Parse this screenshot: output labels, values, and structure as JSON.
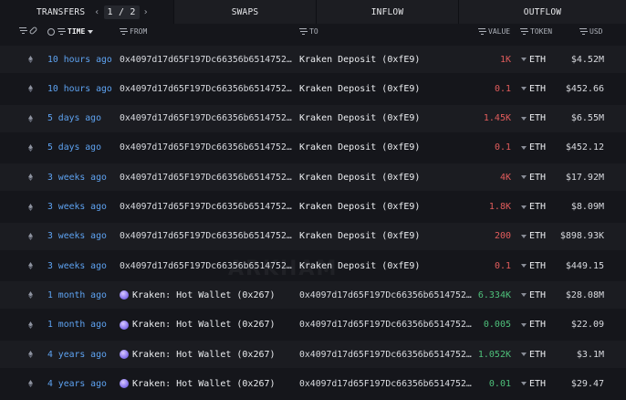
{
  "tabs": {
    "active": "TRANSFERS",
    "pager": "1 / 2",
    "prev": "‹",
    "next": "›",
    "others": [
      "SWAPS",
      "INFLOW",
      "OUTFLOW"
    ]
  },
  "header": {
    "time": "TIME",
    "from": "FROM",
    "to": "TO",
    "value": "VALUE",
    "token": "TOKEN",
    "usd": "USD"
  },
  "watermark": "ARKHAM",
  "colors": {
    "time_link": "#5ea3f2",
    "value_out": "#e25c5c",
    "value_in": "#4ec07a",
    "background": "#15161b",
    "alt_row": "#1b1c21"
  },
  "rows": [
    {
      "time": "10 hours ago",
      "from": "0x4097d17d65F197Dc66356b6514752…",
      "to": "Kraken Deposit (0xfE9)",
      "value": "1K",
      "token": "ETH",
      "usd": "$4.52M",
      "direction": "out"
    },
    {
      "time": "10 hours ago",
      "from": "0x4097d17d65F197Dc66356b6514752…",
      "to": "Kraken Deposit (0xfE9)",
      "value": "0.1",
      "token": "ETH",
      "usd": "$452.66",
      "direction": "out"
    },
    {
      "time": "5 days ago",
      "from": "0x4097d17d65F197Dc66356b6514752…",
      "to": "Kraken Deposit (0xfE9)",
      "value": "1.45K",
      "token": "ETH",
      "usd": "$6.55M",
      "direction": "out"
    },
    {
      "time": "5 days ago",
      "from": "0x4097d17d65F197Dc66356b6514752…",
      "to": "Kraken Deposit (0xfE9)",
      "value": "0.1",
      "token": "ETH",
      "usd": "$452.12",
      "direction": "out"
    },
    {
      "time": "3 weeks ago",
      "from": "0x4097d17d65F197Dc66356b6514752…",
      "to": "Kraken Deposit (0xfE9)",
      "value": "4K",
      "token": "ETH",
      "usd": "$17.92M",
      "direction": "out"
    },
    {
      "time": "3 weeks ago",
      "from": "0x4097d17d65F197Dc66356b6514752…",
      "to": "Kraken Deposit (0xfE9)",
      "value": "1.8K",
      "token": "ETH",
      "usd": "$8.09M",
      "direction": "out"
    },
    {
      "time": "3 weeks ago",
      "from": "0x4097d17d65F197Dc66356b6514752…",
      "to": "Kraken Deposit (0xfE9)",
      "value": "200",
      "token": "ETH",
      "usd": "$898.93K",
      "direction": "out"
    },
    {
      "time": "3 weeks ago",
      "from": "0x4097d17d65F197Dc66356b6514752…",
      "to": "Kraken Deposit (0xfE9)",
      "value": "0.1",
      "token": "ETH",
      "usd": "$449.15",
      "direction": "out"
    },
    {
      "time": "1 month ago",
      "from": "Kraken: Hot Wallet (0x267)",
      "to": "0x4097d17d65F197Dc66356b6514752…",
      "value": "6.334K",
      "token": "ETH",
      "usd": "$28.08M",
      "direction": "in"
    },
    {
      "time": "1 month ago",
      "from": "Kraken: Hot Wallet (0x267)",
      "to": "0x4097d17d65F197Dc66356b6514752…",
      "value": "0.005",
      "token": "ETH",
      "usd": "$22.09",
      "direction": "in"
    },
    {
      "time": "4 years ago",
      "from": "Kraken: Hot Wallet (0x267)",
      "to": "0x4097d17d65F197Dc66356b6514752…",
      "value": "1.052K",
      "token": "ETH",
      "usd": "$3.1M",
      "direction": "in"
    },
    {
      "time": "4 years ago",
      "from": "Kraken: Hot Wallet (0x267)",
      "to": "0x4097d17d65F197Dc66356b6514752…",
      "value": "0.01",
      "token": "ETH",
      "usd": "$29.47",
      "direction": "in"
    }
  ]
}
